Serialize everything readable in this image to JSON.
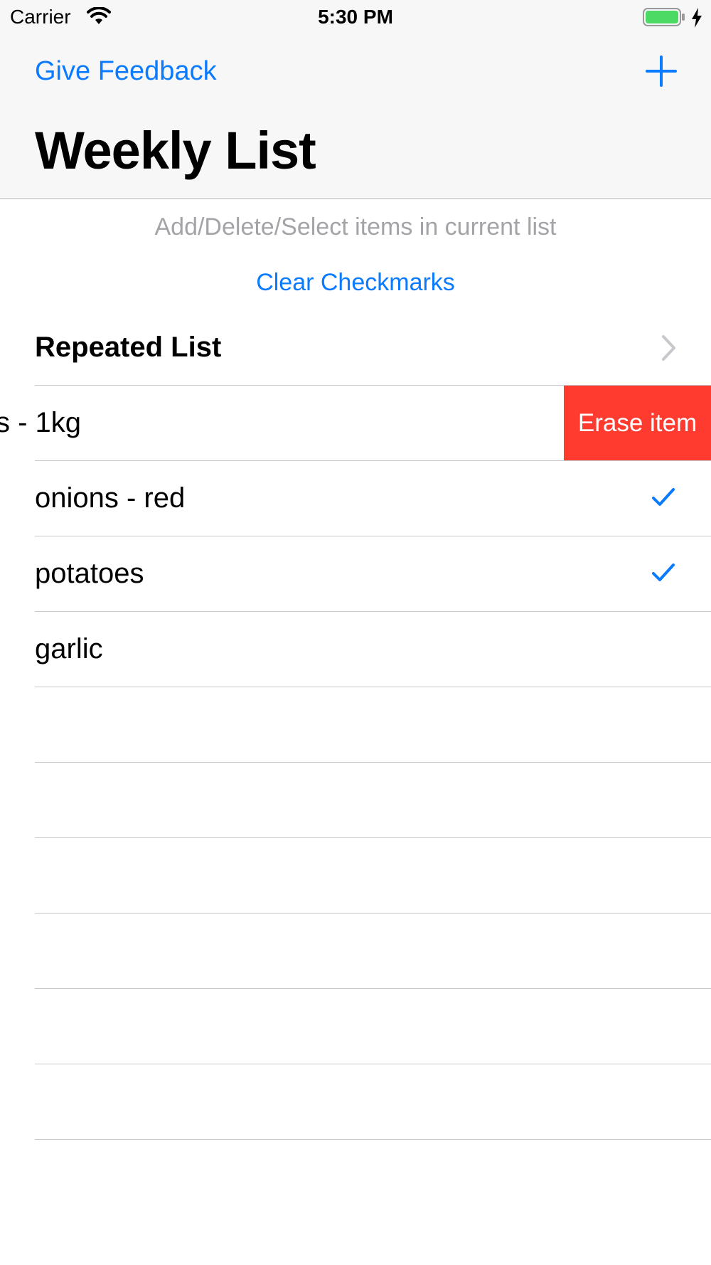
{
  "status_bar": {
    "carrier": "Carrier",
    "time": "5:30 PM",
    "wifi_icon": "wifi-icon",
    "battery_icon": "battery-charging-icon",
    "battery_color": "#4cd964"
  },
  "nav": {
    "left_button": "Give Feedback",
    "add_icon": "plus-icon",
    "title": "Weekly List",
    "accent_color": "#0a7aff"
  },
  "list": {
    "hint": "Add/Delete/Select items in current list",
    "clear_label": "Clear Checkmarks",
    "repeated_label": "Repeated List",
    "swiped_item": {
      "label": "s - 1kg",
      "action_label": "Erase item",
      "action_color": "#ff3b30"
    },
    "items": [
      {
        "label": "onions - red",
        "checked": true
      },
      {
        "label": "potatoes",
        "checked": true
      },
      {
        "label": "garlic",
        "checked": false
      }
    ]
  }
}
